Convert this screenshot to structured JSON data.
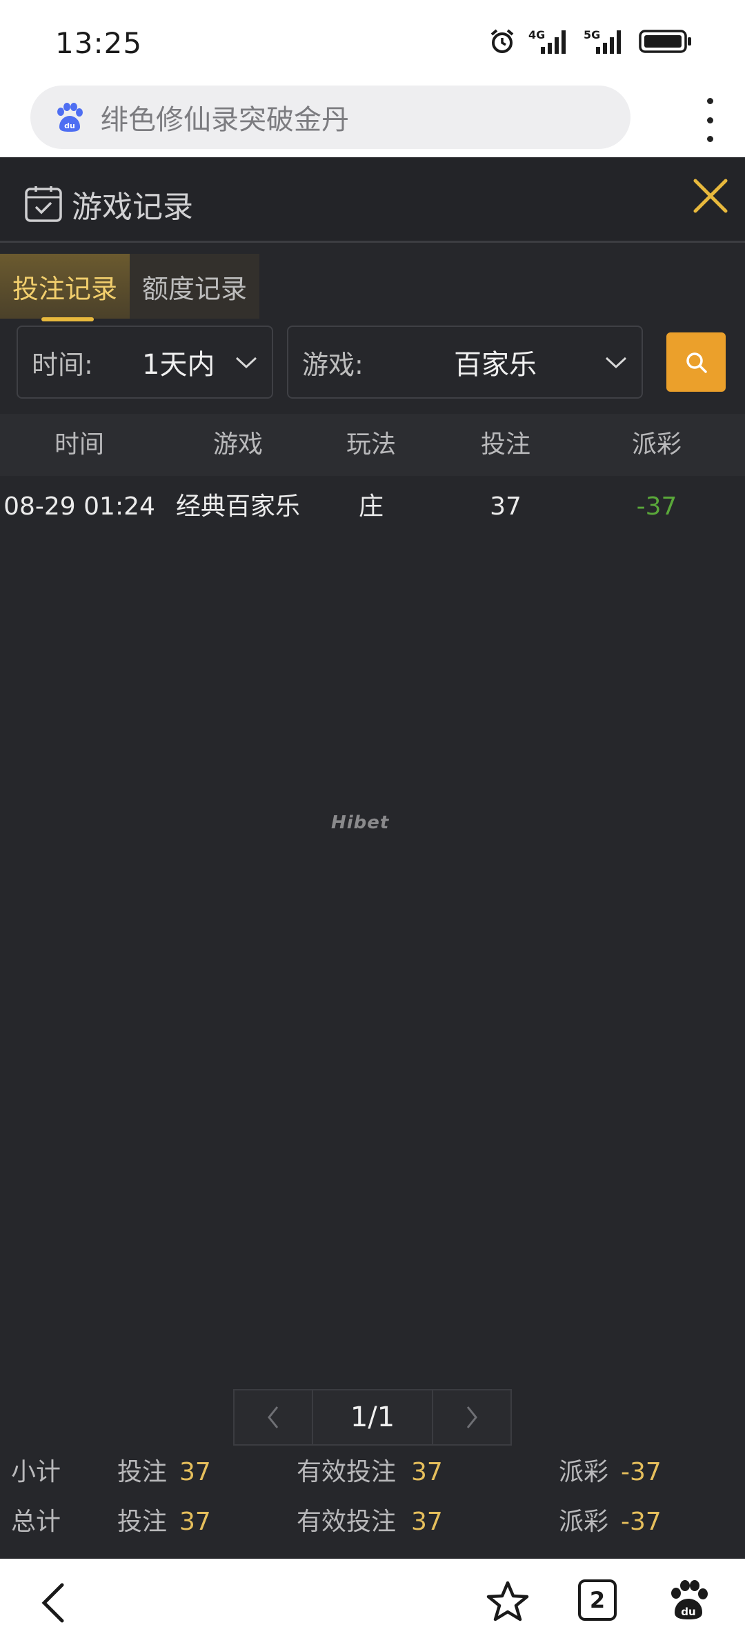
{
  "status_bar": {
    "time": "13:25",
    "network_1": "4G",
    "network_2": "5G"
  },
  "browser": {
    "url_text": "绯色修仙录突破金丹",
    "tab_count": "2"
  },
  "modal": {
    "title": "游戏记录"
  },
  "tabs": [
    {
      "label": "投注记录",
      "active": true
    },
    {
      "label": "额度记录",
      "active": false
    }
  ],
  "filters": {
    "time_label": "时间:",
    "time_value": "1天内",
    "game_label": "游戏:",
    "game_value": "百家乐"
  },
  "table": {
    "headers": [
      "时间",
      "游戏",
      "玩法",
      "投注",
      "派彩"
    ],
    "rows": [
      {
        "time": "08-29 01:24",
        "game": "经典百家乐",
        "play": "庄",
        "bet": "37",
        "payout": "-37"
      }
    ]
  },
  "watermark": "Hibet",
  "pagination": {
    "current": "1/1"
  },
  "summary": {
    "subtotal_label": "小计",
    "total_label": "总计",
    "bet_label": "投注",
    "valid_bet_label": "有效投注",
    "payout_label": "派彩",
    "subtotal": {
      "bet": "37",
      "valid_bet": "37",
      "payout": "-37"
    },
    "total": {
      "bet": "37",
      "valid_bet": "37",
      "payout": "-37"
    }
  },
  "colors": {
    "accent_gold": "#e6bf5c",
    "search_button": "#eba02b",
    "negative_payout": "#5aa83a",
    "background": "#26272b"
  }
}
